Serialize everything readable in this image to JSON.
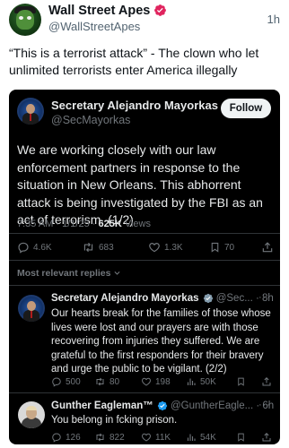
{
  "outer_post": {
    "author_name": "Wall Street Apes",
    "handle": "@WallStreetApes",
    "time": "1h",
    "text": "“This is a terrorist attack” - The clown who let unlimited terrorists enter America illegally"
  },
  "embedded": {
    "main_post": {
      "author_name": "Secretary Alejandro Mayorkas",
      "handle": "@SecMayorkas",
      "follow_label": "Follow",
      "text": "We are working closely with our law enforcement partners in response to the situation in New Orleans. This abhorrent attack is being investigated by the FBI as an act of terrorism. (1/2)",
      "time": "7:35 AM · 1/1/25 · ",
      "views_count": "625K",
      "views_label": " Views",
      "stats": {
        "replies": "4.6K",
        "reposts": "683",
        "likes": "1.3K",
        "bookmarks": "70"
      }
    },
    "most_relevant_label": "Most relevant replies",
    "replies": [
      {
        "author_name": "Secretary Alejandro Mayorkas",
        "handle_time": "@Sec... · 8h",
        "more": "···",
        "text": "Our hearts break for the families of those whose lives were lost and our prayers are with those recovering from injuries they suffered. We are grateful to the first responders for their bravery and urge the public to be vigilant. (2/2)",
        "stats": {
          "replies": "500",
          "reposts": "80",
          "likes": "198",
          "views": "50K"
        }
      },
      {
        "author_name": "Gunther Eagleman™",
        "handle_time": "@GuntherEagle... · 6h",
        "more": "···",
        "text": "You belong in fcking prison.",
        "stats": {
          "replies": "126",
          "reposts": "822",
          "likes": "11K",
          "views": "54K"
        }
      }
    ]
  },
  "colors": {
    "verified_blue": "#1d9bf0",
    "verified_gold": "#e0245e",
    "verified_gray": "#829aab",
    "dark_bg": "#000000",
    "muted_text": "#71767b"
  }
}
